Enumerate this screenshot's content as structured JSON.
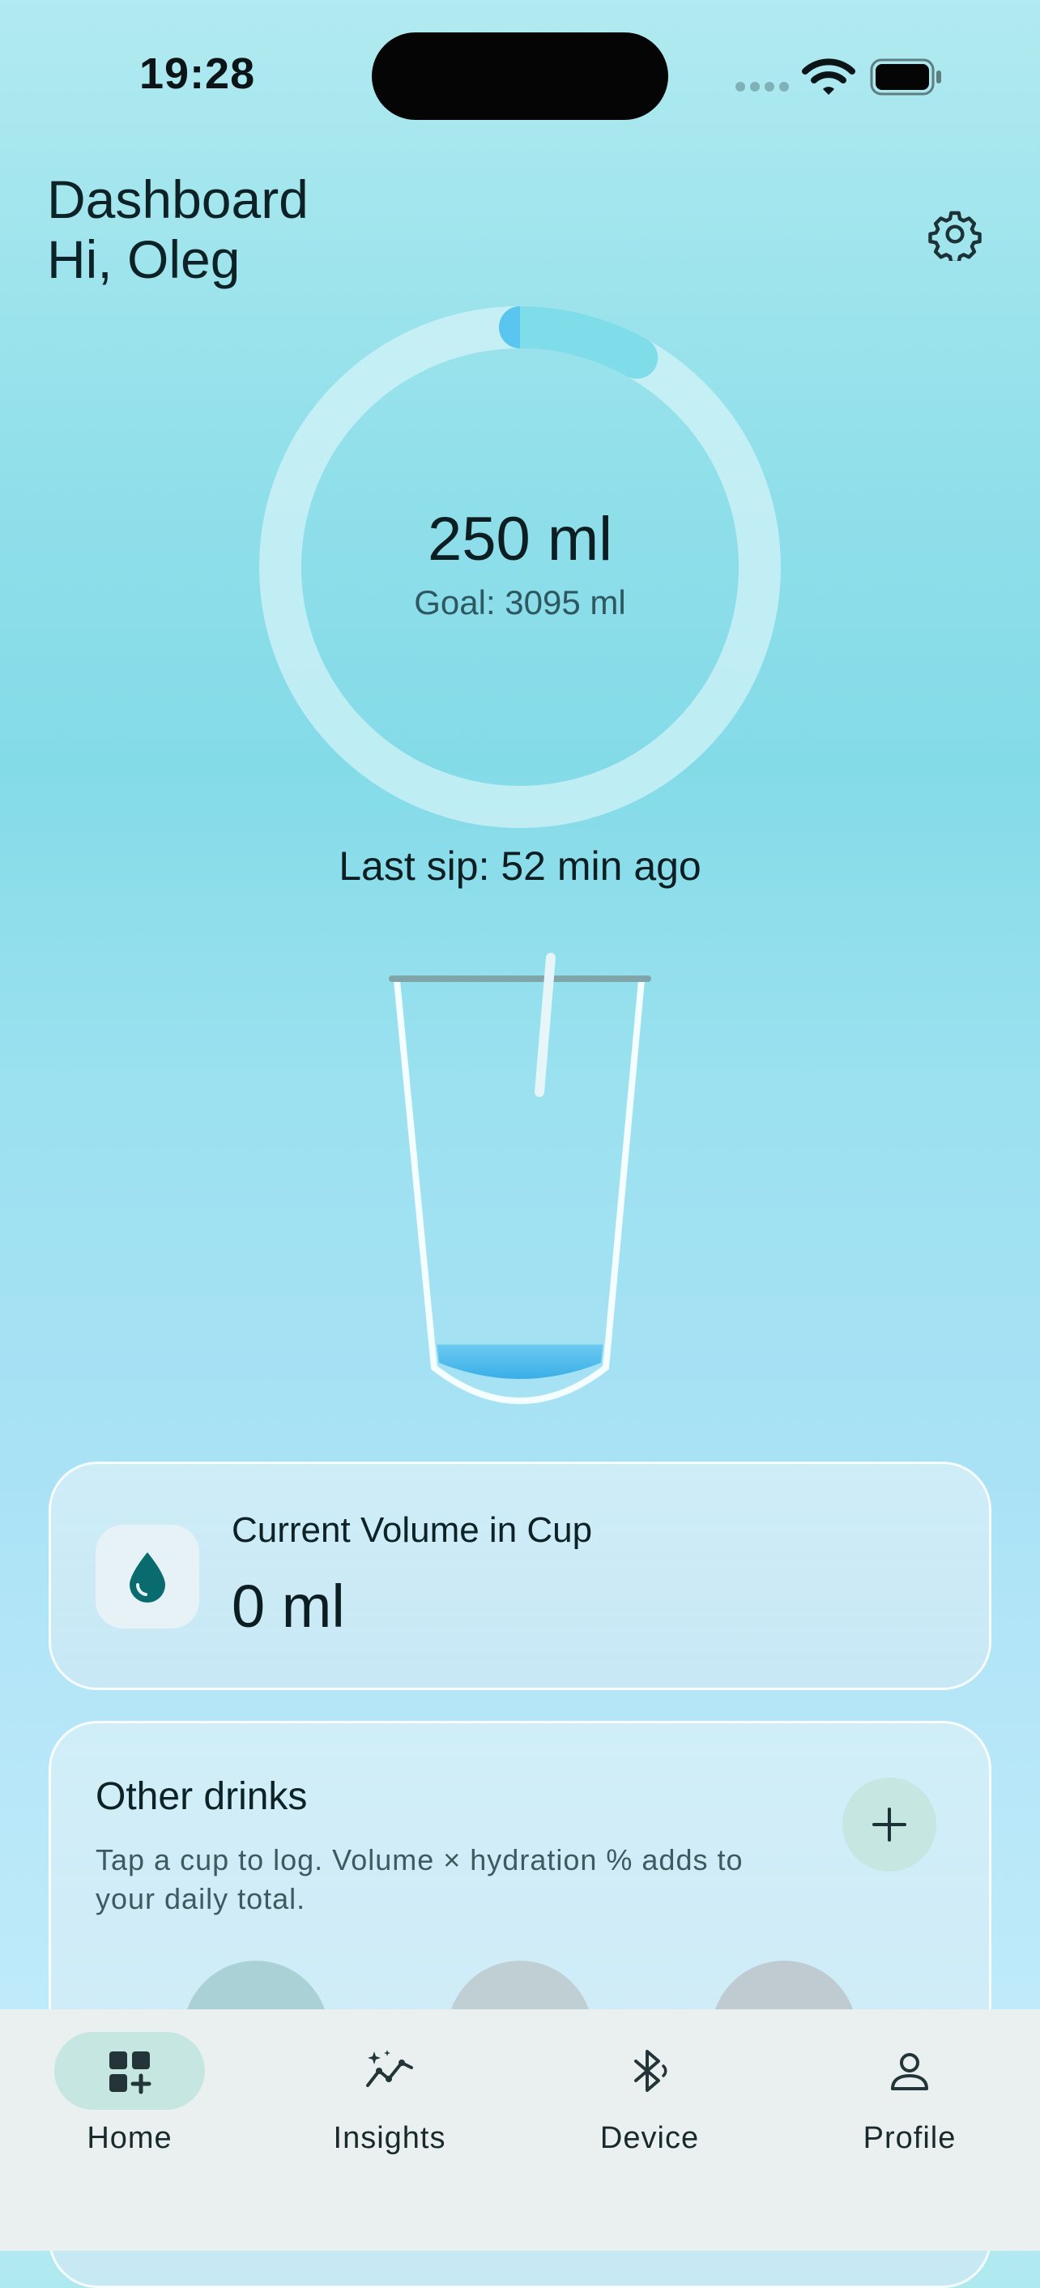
{
  "status_bar": {
    "time": "19:28"
  },
  "header": {
    "title": "Dashboard",
    "greeting": "Hi, Oleg"
  },
  "progress": {
    "value_text": "250 ml",
    "goal_text": "Goal: 3095 ml",
    "consumed_ml": 250,
    "goal_ml": 3095,
    "ring_fraction": 0.081
  },
  "last_sip": "Last sip: 52 min ago",
  "cup_fill_fraction": 0.06,
  "volume_card": {
    "label": "Current Volume in Cup",
    "value": "0 ml",
    "icon": "water-drop-icon"
  },
  "other_drinks": {
    "title": "Other drinks",
    "hint": "Tap a cup to log. Volume × hydration % adds to your daily total.",
    "add_icon": "plus-icon"
  },
  "nav": {
    "active": "Home",
    "items": [
      {
        "label": "Home",
        "icon": "dashboard-add-icon"
      },
      {
        "label": "Insights",
        "icon": "insights-sparkle-icon"
      },
      {
        "label": "Device",
        "icon": "bluetooth-icon"
      },
      {
        "label": "Profile",
        "icon": "person-icon"
      }
    ]
  },
  "colors": {
    "accent_ring": "#7fdde9",
    "ring_start": "#5ac6f0",
    "water": "#45b6ec",
    "drop": "#0a6b6f",
    "nav_active": "#c6e6e2"
  }
}
